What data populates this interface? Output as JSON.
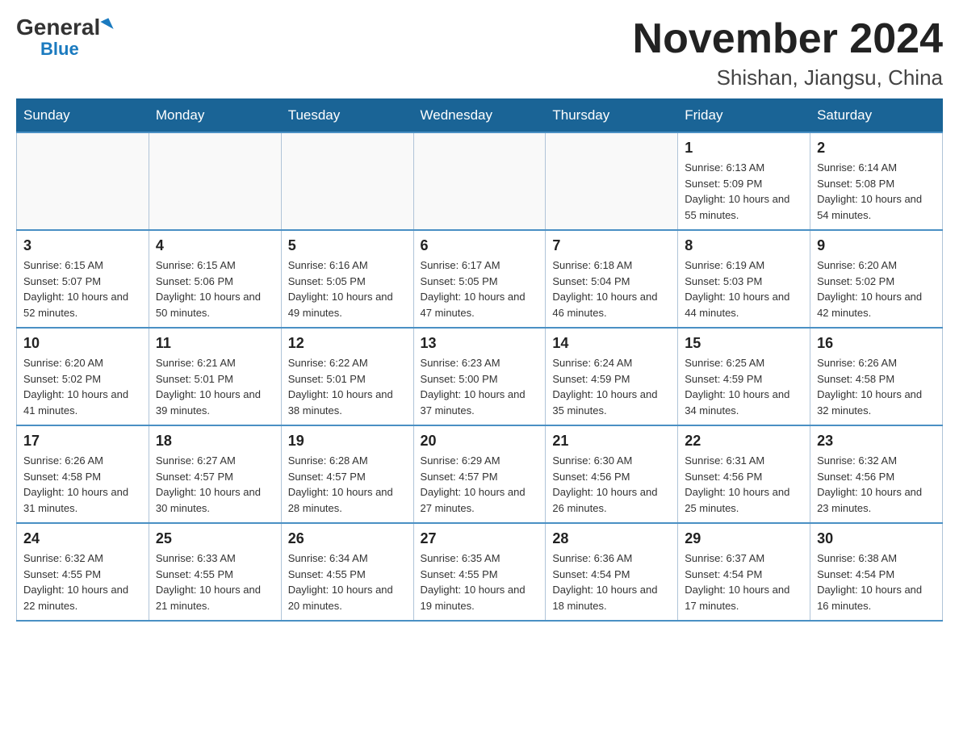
{
  "header": {
    "logo_general": "General",
    "logo_blue": "Blue",
    "month_title": "November 2024",
    "location": "Shishan, Jiangsu, China"
  },
  "weekdays": [
    "Sunday",
    "Monday",
    "Tuesday",
    "Wednesday",
    "Thursday",
    "Friday",
    "Saturday"
  ],
  "weeks": [
    [
      {
        "day": "",
        "info": ""
      },
      {
        "day": "",
        "info": ""
      },
      {
        "day": "",
        "info": ""
      },
      {
        "day": "",
        "info": ""
      },
      {
        "day": "",
        "info": ""
      },
      {
        "day": "1",
        "info": "Sunrise: 6:13 AM\nSunset: 5:09 PM\nDaylight: 10 hours and 55 minutes."
      },
      {
        "day": "2",
        "info": "Sunrise: 6:14 AM\nSunset: 5:08 PM\nDaylight: 10 hours and 54 minutes."
      }
    ],
    [
      {
        "day": "3",
        "info": "Sunrise: 6:15 AM\nSunset: 5:07 PM\nDaylight: 10 hours and 52 minutes."
      },
      {
        "day": "4",
        "info": "Sunrise: 6:15 AM\nSunset: 5:06 PM\nDaylight: 10 hours and 50 minutes."
      },
      {
        "day": "5",
        "info": "Sunrise: 6:16 AM\nSunset: 5:05 PM\nDaylight: 10 hours and 49 minutes."
      },
      {
        "day": "6",
        "info": "Sunrise: 6:17 AM\nSunset: 5:05 PM\nDaylight: 10 hours and 47 minutes."
      },
      {
        "day": "7",
        "info": "Sunrise: 6:18 AM\nSunset: 5:04 PM\nDaylight: 10 hours and 46 minutes."
      },
      {
        "day": "8",
        "info": "Sunrise: 6:19 AM\nSunset: 5:03 PM\nDaylight: 10 hours and 44 minutes."
      },
      {
        "day": "9",
        "info": "Sunrise: 6:20 AM\nSunset: 5:02 PM\nDaylight: 10 hours and 42 minutes."
      }
    ],
    [
      {
        "day": "10",
        "info": "Sunrise: 6:20 AM\nSunset: 5:02 PM\nDaylight: 10 hours and 41 minutes."
      },
      {
        "day": "11",
        "info": "Sunrise: 6:21 AM\nSunset: 5:01 PM\nDaylight: 10 hours and 39 minutes."
      },
      {
        "day": "12",
        "info": "Sunrise: 6:22 AM\nSunset: 5:01 PM\nDaylight: 10 hours and 38 minutes."
      },
      {
        "day": "13",
        "info": "Sunrise: 6:23 AM\nSunset: 5:00 PM\nDaylight: 10 hours and 37 minutes."
      },
      {
        "day": "14",
        "info": "Sunrise: 6:24 AM\nSunset: 4:59 PM\nDaylight: 10 hours and 35 minutes."
      },
      {
        "day": "15",
        "info": "Sunrise: 6:25 AM\nSunset: 4:59 PM\nDaylight: 10 hours and 34 minutes."
      },
      {
        "day": "16",
        "info": "Sunrise: 6:26 AM\nSunset: 4:58 PM\nDaylight: 10 hours and 32 minutes."
      }
    ],
    [
      {
        "day": "17",
        "info": "Sunrise: 6:26 AM\nSunset: 4:58 PM\nDaylight: 10 hours and 31 minutes."
      },
      {
        "day": "18",
        "info": "Sunrise: 6:27 AM\nSunset: 4:57 PM\nDaylight: 10 hours and 30 minutes."
      },
      {
        "day": "19",
        "info": "Sunrise: 6:28 AM\nSunset: 4:57 PM\nDaylight: 10 hours and 28 minutes."
      },
      {
        "day": "20",
        "info": "Sunrise: 6:29 AM\nSunset: 4:57 PM\nDaylight: 10 hours and 27 minutes."
      },
      {
        "day": "21",
        "info": "Sunrise: 6:30 AM\nSunset: 4:56 PM\nDaylight: 10 hours and 26 minutes."
      },
      {
        "day": "22",
        "info": "Sunrise: 6:31 AM\nSunset: 4:56 PM\nDaylight: 10 hours and 25 minutes."
      },
      {
        "day": "23",
        "info": "Sunrise: 6:32 AM\nSunset: 4:56 PM\nDaylight: 10 hours and 23 minutes."
      }
    ],
    [
      {
        "day": "24",
        "info": "Sunrise: 6:32 AM\nSunset: 4:55 PM\nDaylight: 10 hours and 22 minutes."
      },
      {
        "day": "25",
        "info": "Sunrise: 6:33 AM\nSunset: 4:55 PM\nDaylight: 10 hours and 21 minutes."
      },
      {
        "day": "26",
        "info": "Sunrise: 6:34 AM\nSunset: 4:55 PM\nDaylight: 10 hours and 20 minutes."
      },
      {
        "day": "27",
        "info": "Sunrise: 6:35 AM\nSunset: 4:55 PM\nDaylight: 10 hours and 19 minutes."
      },
      {
        "day": "28",
        "info": "Sunrise: 6:36 AM\nSunset: 4:54 PM\nDaylight: 10 hours and 18 minutes."
      },
      {
        "day": "29",
        "info": "Sunrise: 6:37 AM\nSunset: 4:54 PM\nDaylight: 10 hours and 17 minutes."
      },
      {
        "day": "30",
        "info": "Sunrise: 6:38 AM\nSunset: 4:54 PM\nDaylight: 10 hours and 16 minutes."
      }
    ]
  ]
}
